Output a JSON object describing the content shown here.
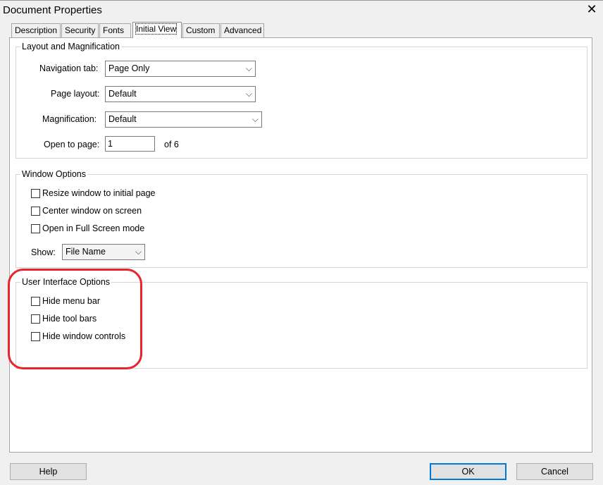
{
  "window": {
    "title": "Document Properties",
    "close_glyph": "✕"
  },
  "tabs": [
    {
      "label": "Description"
    },
    {
      "label": "Security"
    },
    {
      "label": "Fonts"
    },
    {
      "label": "Initial View",
      "active": true
    },
    {
      "label": "Custom"
    },
    {
      "label": "Advanced"
    }
  ],
  "layout_group": {
    "title": "Layout and Magnification",
    "navigation_tab": {
      "label": "Navigation tab:",
      "value": "Page Only"
    },
    "page_layout": {
      "label": "Page layout:",
      "value": "Default"
    },
    "magnification": {
      "label": "Magnification:",
      "value": "Default"
    },
    "open_to_page": {
      "label": "Open to page:",
      "value": "1",
      "suffix": "of 6"
    }
  },
  "window_group": {
    "title": "Window Options",
    "options": [
      {
        "label": "Resize window to initial page",
        "checked": false
      },
      {
        "label": "Center window on screen",
        "checked": false
      },
      {
        "label": "Open in Full Screen mode",
        "checked": false
      }
    ],
    "show": {
      "label": "Show:",
      "value": "File Name"
    }
  },
  "ui_group": {
    "title": "User Interface Options",
    "options": [
      {
        "label": "Hide menu bar",
        "checked": false
      },
      {
        "label": "Hide tool bars",
        "checked": false
      },
      {
        "label": "Hide window controls",
        "checked": false
      }
    ]
  },
  "buttons": {
    "help": "Help",
    "ok": "OK",
    "cancel": "Cancel"
  },
  "icons": {
    "dropdown_arrow": "chevron-down-icon"
  },
  "colors": {
    "annotation_highlight": "#e8242c",
    "default_button_border": "#0078d7"
  }
}
